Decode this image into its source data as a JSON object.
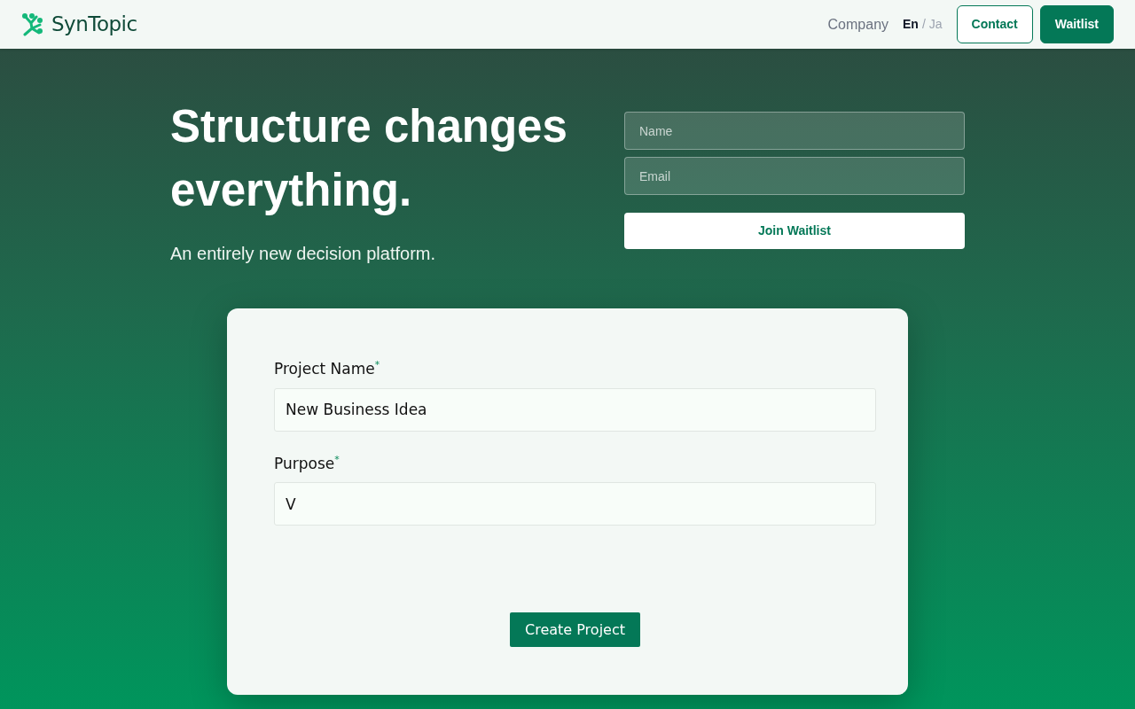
{
  "brand": {
    "name": "SynTopic"
  },
  "nav": {
    "links": [
      "Company"
    ],
    "languages": [
      {
        "label": "En",
        "selected": true
      },
      {
        "label": "Ja",
        "selected": false
      }
    ],
    "separator": "/",
    "buttons": [
      {
        "label": "Contact",
        "kind": "outline"
      },
      {
        "label": "Waitlist",
        "kind": "solid"
      }
    ]
  },
  "hero": {
    "title": "Structure changes everything.",
    "subtitle": "An entirely new decision platform.",
    "signup": {
      "fields": [
        {
          "placeholder": "Name"
        },
        {
          "placeholder": "Email"
        }
      ],
      "button": "Join Waitlist"
    }
  },
  "project_form": {
    "fields": [
      {
        "label": "Project Name",
        "required_mark": "*",
        "value": "New Business Idea"
      },
      {
        "label": "Purpose",
        "required_mark": "*",
        "value": "V"
      }
    ],
    "button": "Create Project"
  }
}
